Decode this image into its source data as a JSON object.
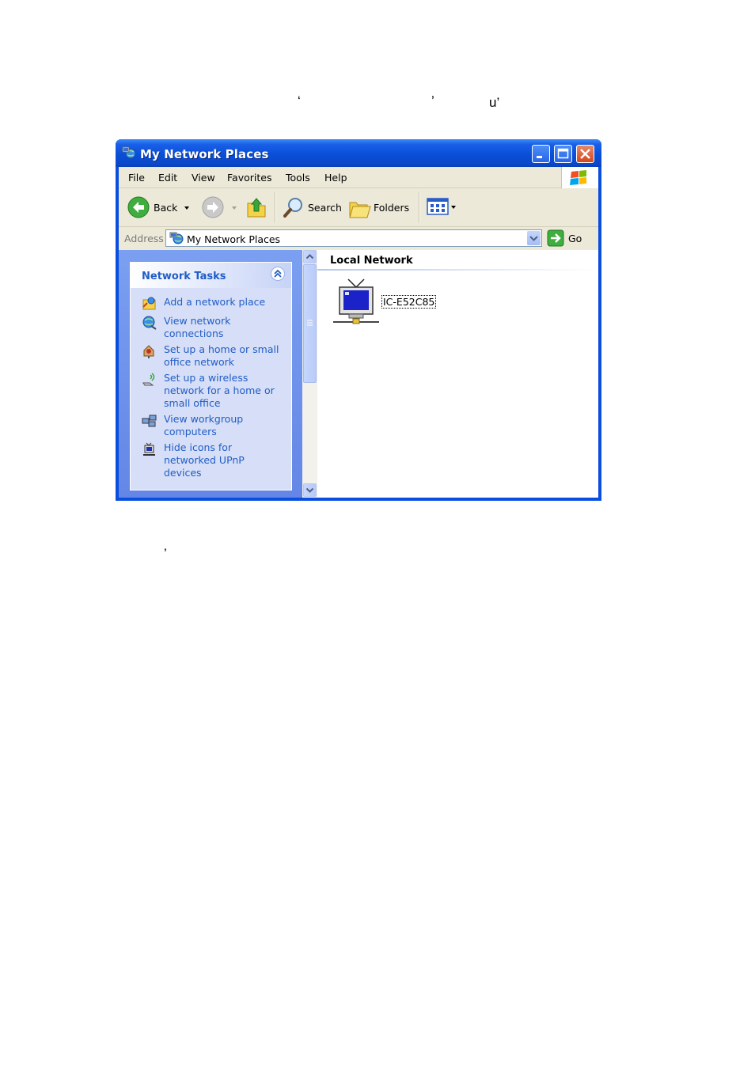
{
  "page": {
    "stray_marks": [
      "‘",
      "’",
      "u’",
      "’"
    ]
  },
  "window": {
    "title": "My Network Places",
    "controls": {
      "minimize": "minimize-icon",
      "maximize": "maximize-icon",
      "close": "close-icon"
    }
  },
  "menubar": {
    "items": [
      "File",
      "Edit",
      "View",
      "Favorites",
      "Tools",
      "Help"
    ]
  },
  "toolbar": {
    "back_label": "Back",
    "search_label": "Search",
    "folders_label": "Folders"
  },
  "address": {
    "label": "Address",
    "value": "My Network Places",
    "go_label": "Go"
  },
  "tasks": {
    "title": "Network Tasks",
    "items": [
      {
        "label": "Add a network place",
        "icon": "add-network-place-icon"
      },
      {
        "label": "View network connections",
        "icon": "network-connections-icon"
      },
      {
        "label": "Set up a home or small office network",
        "icon": "home-network-icon"
      },
      {
        "label": "Set up a wireless network for a home or small office",
        "icon": "wireless-network-icon"
      },
      {
        "label": "View workgroup computers",
        "icon": "workgroup-icon"
      },
      {
        "label": "Hide icons for networked UPnP devices",
        "icon": "upnp-device-icon"
      }
    ]
  },
  "content": {
    "group_title": "Local Network",
    "items": [
      {
        "label": "IC-E52C85",
        "icon": "network-device-icon"
      }
    ]
  },
  "colors": {
    "titlebar": "#0a4fd8",
    "task_link": "#215dc6",
    "taskpane_bg": "#7b9ff1"
  }
}
